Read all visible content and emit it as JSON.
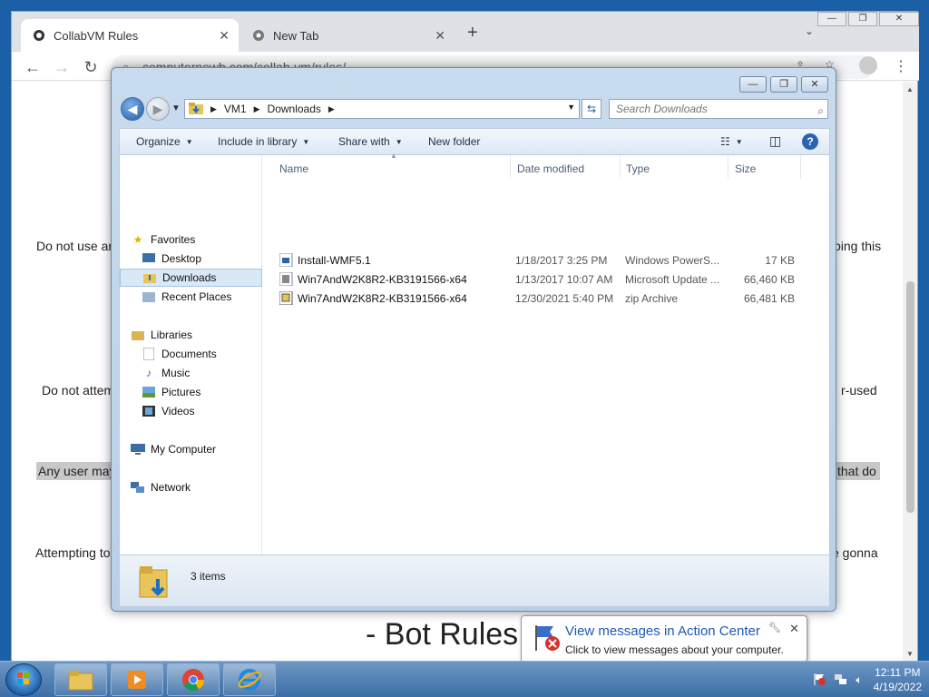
{
  "browser": {
    "tabs": [
      {
        "title": "CollabVM Rules",
        "close": "✕"
      },
      {
        "title": "New Tab",
        "close": "✕"
      }
    ],
    "new_tab": "+",
    "url": "computernewb.com/collab-vm/rules/",
    "window_controls": [
      "—",
      "❐",
      "✕"
    ]
  },
  "page": {
    "line1_left": "Do not use ar",
    "line1_right": "ping this",
    "line2_left": "Do not attem",
    "line2_right": "r-used",
    "line3_left": "Any user may",
    "line3_right": "that do",
    "line4_left": "Attempting to",
    "line4_right": "e gonna",
    "heading": "- Bot Rules"
  },
  "explorer": {
    "breadcrumb": [
      "VM1",
      "Downloads"
    ],
    "search_placeholder": "Search Downloads",
    "toolbar": {
      "organize": "Organize",
      "include": "Include in library",
      "share": "Share with",
      "new_folder": "New folder"
    },
    "nav": {
      "favorites": "Favorites",
      "desktop": "Desktop",
      "downloads": "Downloads",
      "recent": "Recent Places",
      "libraries": "Libraries",
      "documents": "Documents",
      "music": "Music",
      "pictures": "Pictures",
      "videos": "Videos",
      "computer": "My Computer",
      "network": "Network"
    },
    "columns": [
      "Name",
      "Date modified",
      "Type",
      "Size"
    ],
    "files": [
      {
        "name": "Install-WMF5.1",
        "date": "1/18/2017 3:25 PM",
        "type": "Windows PowerS...",
        "size": "17 KB"
      },
      {
        "name": "Win7AndW2K8R2-KB3191566-x64",
        "date": "1/13/2017 10:07 AM",
        "type": "Microsoft Update ...",
        "size": "66,460 KB"
      },
      {
        "name": "Win7AndW2K8R2-KB3191566-x64",
        "date": "12/30/2021 5:40 PM",
        "type": "zip Archive",
        "size": "66,481 KB"
      }
    ],
    "item_count": "3 items"
  },
  "notification": {
    "title": "View messages in Action Center",
    "body": "Click to view messages about your computer."
  },
  "taskbar": {
    "time": "12:11 PM",
    "date": "4/19/2022"
  }
}
